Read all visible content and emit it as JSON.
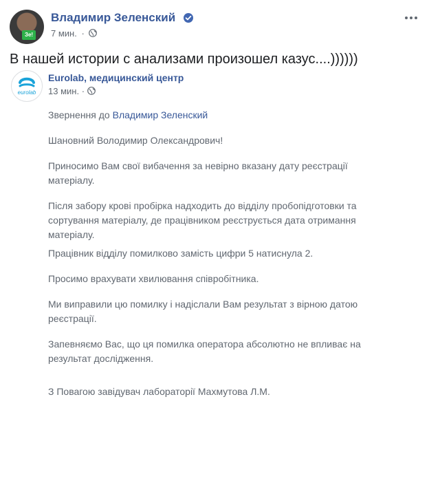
{
  "post": {
    "author": "Владимир Зеленский",
    "time": "7 мин.",
    "text": "В нашей истории с анализами произошел казус....))))))",
    "avatar_badge": "Зе!"
  },
  "shared": {
    "author": "Eurolab, медицинский центр",
    "time": "13 мин.",
    "logo_text": "eurolab",
    "body": {
      "address_prefix": "Звернення до ",
      "address_name": "Владимир Зеленский",
      "p1": "Шановний Володимир Олександрович!",
      "p2": "Приносимо Вам свої вибачення за невірно вказану дату реєстрації матеріалу.",
      "p3": "Після забору крові пробірка надходить до відділу пробопідготовки та сортування матеріалу, де працівником реєструється дата отримання матеріалу.",
      "p4": "Працівник відділу помилково замість цифри 5 натиснула 2.",
      "p5": "Просимо врахувати хвилювання співробітника.",
      "p6": "Ми виправили цю помилку і надіслали Вам результат з вірною датою реєстрації.",
      "p7": "Запевняємо Вас, що ця помилка оператора абсолютно не впливає на результат дослідження.",
      "p8": "З Повагою завідувач лабораторії Махмутова Л.М."
    }
  },
  "colors": {
    "link": "#385898",
    "secondary_text": "#606770",
    "primary_text": "#1c1e21",
    "verified": "#4267b2",
    "eurolab_blue": "#1aa3d9"
  }
}
